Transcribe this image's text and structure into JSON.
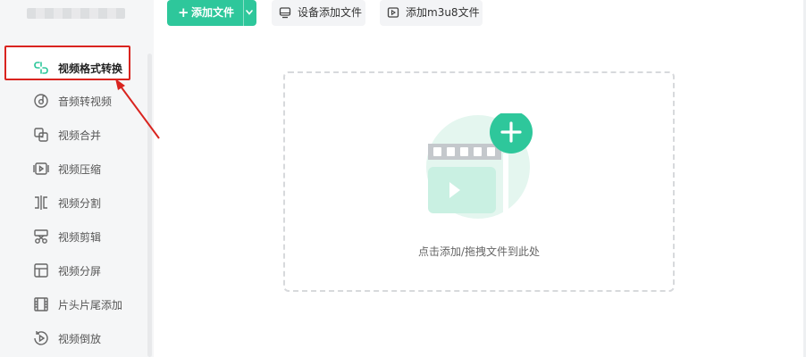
{
  "sidebar": {
    "items": [
      {
        "label": "视频格式转换",
        "icon": "format-convert-icon",
        "active": true
      },
      {
        "label": "音频转视频",
        "icon": "audio-disc-icon",
        "active": false
      },
      {
        "label": "视频合并",
        "icon": "merge-icon",
        "active": false
      },
      {
        "label": "视频压缩",
        "icon": "compress-icon",
        "active": false
      },
      {
        "label": "视频分割",
        "icon": "split-icon",
        "active": false
      },
      {
        "label": "视频剪辑",
        "icon": "scissors-icon",
        "active": false
      },
      {
        "label": "视频分屏",
        "icon": "split-screen-icon",
        "active": false
      },
      {
        "label": "片头片尾添加",
        "icon": "film-strip-icon",
        "active": false
      },
      {
        "label": "视频倒放",
        "icon": "reverse-play-icon",
        "active": false
      }
    ]
  },
  "toolbar": {
    "add_file_label": "添加文件",
    "device_add_label": "设备添加文件",
    "add_m3u8_label": "添加m3u8文件"
  },
  "dropzone": {
    "hint": "点击添加/拖拽文件到此处"
  },
  "colors": {
    "accent": "#2ec79b",
    "highlight": "#d9241f",
    "illustration_light": "#e4f6ef",
    "illustration_mid": "#c9f0e2"
  }
}
